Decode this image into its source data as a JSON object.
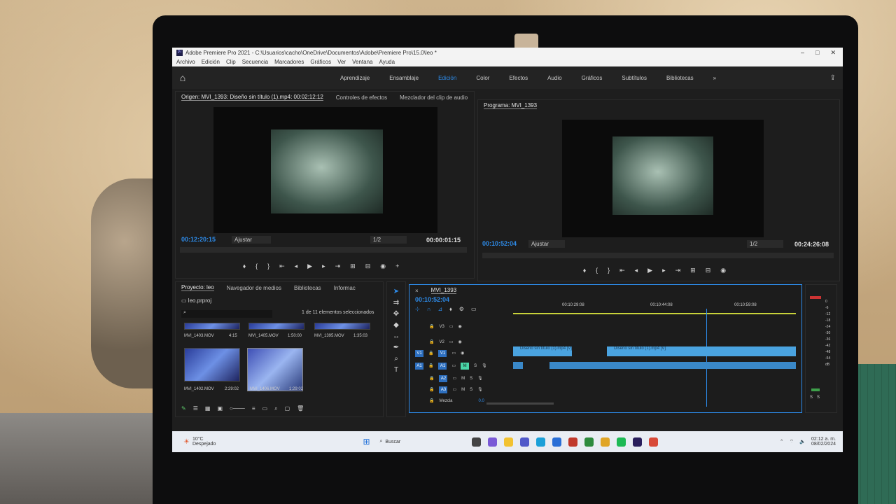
{
  "window": {
    "title": "Adobe Premiere Pro 2021 - C:\\Usuarios\\cacho\\OneDrive\\Documentos\\Adobe\\Premiere Pro\\15.0\\leo *"
  },
  "menu": [
    "Archivo",
    "Edición",
    "Clip",
    "Secuencia",
    "Marcadores",
    "Gráficos",
    "Ver",
    "Ventana",
    "Ayuda"
  ],
  "workspaces": [
    "Aprendizaje",
    "Ensamblaje",
    "Edición",
    "Color",
    "Efectos",
    "Audio",
    "Gráficos",
    "Subtítulos",
    "Bibliotecas"
  ],
  "active_workspace": "Edición",
  "source_panel": {
    "tabs": [
      "Origen: MVI_1393: Diseño sin título (1).mp4: 00:02:12:12",
      "Controles de efectos",
      "Mezclador del clip de audio"
    ],
    "timecode": "00:12:20:15",
    "fit": "Ajustar",
    "resolution": "1/2",
    "duration": "00:00:01:15"
  },
  "program_panel": {
    "tab": "Programa: MVI_1393",
    "timecode": "00:10:52:04",
    "fit": "Ajustar",
    "resolution": "1/2",
    "duration": "00:24:26:08"
  },
  "project_panel": {
    "tabs": [
      "Proyecto: leo",
      "Navegador de medios",
      "Bibliotecas",
      "Informac"
    ],
    "file": "leo.prproj",
    "selection": "1 de 11 elementos seleccionados",
    "items": [
      {
        "name": "MVI_1403.MOV",
        "duration": "4:15"
      },
      {
        "name": "MVI_1405.MOV",
        "duration": "1:50:00"
      },
      {
        "name": "MVI_1395.MOV",
        "duration": "1:35:03"
      },
      {
        "name": "MVI_1402.MOV",
        "duration": "2:29:02"
      },
      {
        "name": "MVI_1406.MOV",
        "duration": "1:29:02"
      }
    ]
  },
  "timeline": {
    "tab": "MVI_1393",
    "timecode": "00:10:52:04",
    "ruler": [
      "00:10:29:08",
      "00:10:44:08",
      "00:10:59:08"
    ],
    "video_tracks": [
      "V3",
      "V2",
      "V1"
    ],
    "audio_tracks": [
      "A1",
      "A2",
      "A3"
    ],
    "mix_label": "Mezcla",
    "mix_value": "0.0",
    "clip_labels": [
      "Diseño sin título (1).mp4 [V]",
      "Diseño sin título (1).mp4 [V]"
    ]
  },
  "meter": {
    "scale": [
      "0",
      "-6",
      "-12",
      "-18",
      "-24",
      "-30",
      "-36",
      "-42",
      "-48",
      "-54",
      "dB"
    ],
    "solo": [
      "S",
      "S"
    ]
  },
  "taskbar": {
    "weather_temp": "10°C",
    "weather_desc": "Despejado",
    "search": "Buscar",
    "time": "02:12 a. m.",
    "date": "08/02/2024"
  }
}
